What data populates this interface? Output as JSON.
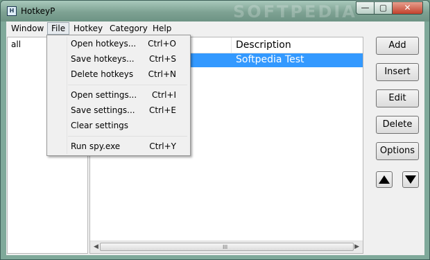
{
  "window": {
    "title": "HotkeyP",
    "icon": "H",
    "watermark": "SOFTPEDIA"
  },
  "window_controls": {
    "minimize": "—",
    "maximize": "▢",
    "close": "✕"
  },
  "menubar": [
    "Window",
    "File",
    "Hotkey",
    "Category",
    "Help"
  ],
  "categories": [
    "all"
  ],
  "list": {
    "columns": [
      "Description"
    ],
    "rows": [
      {
        "description": "Softpedia Test",
        "selected": true
      }
    ],
    "scroll_grip": "III"
  },
  "buttons": {
    "add": "Add",
    "insert": "Insert",
    "edit": "Edit",
    "delete": "Delete",
    "options": "Options"
  },
  "file_menu": [
    {
      "label": "Open hotkeys...",
      "shortcut": "Ctrl+O"
    },
    {
      "label": "Save hotkeys...",
      "shortcut": "Ctrl+S"
    },
    {
      "label": "Delete hotkeys",
      "shortcut": "Ctrl+N"
    },
    {
      "label": "Open settings...",
      "shortcut": "Ctrl+I"
    },
    {
      "label": "Save settings...",
      "shortcut": "Ctrl+E"
    },
    {
      "label": "Clear settings",
      "shortcut": ""
    },
    {
      "label": "Run spy.exe",
      "shortcut": "Ctrl+Y"
    }
  ],
  "colors": {
    "selection": "#3399ff",
    "titlebar": "#7ea293",
    "close_button": "#c2412c"
  }
}
